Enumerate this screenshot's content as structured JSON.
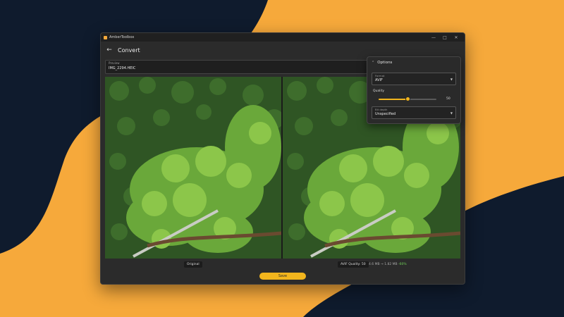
{
  "window": {
    "app_title": "AmberToolbox",
    "controls": {
      "minimize": "—",
      "maximize": "□",
      "close": "✕"
    }
  },
  "header": {
    "back_icon": "←",
    "title": "Convert"
  },
  "preview": {
    "label": "Preview",
    "value": "IMG_2294.HEIC"
  },
  "captions": {
    "original": "Original",
    "converted": "AVIF Quality: 50",
    "size_info": "4.6 MB → 1.82 MB",
    "size_delta": "-60%"
  },
  "save_button": {
    "label": "Save"
  },
  "options": {
    "header": "Options",
    "format": {
      "label": "Format",
      "value": "AVIF"
    },
    "quality": {
      "label": "Quality",
      "value": 50,
      "min": 0,
      "max": 100
    },
    "bit_depth": {
      "label": "Bit depth",
      "value": "Unspecified"
    }
  },
  "colors": {
    "background": "#f6a93b",
    "shape": "#0f1b2d",
    "accent": "#f2b51d",
    "window": "#2b2b2b"
  }
}
